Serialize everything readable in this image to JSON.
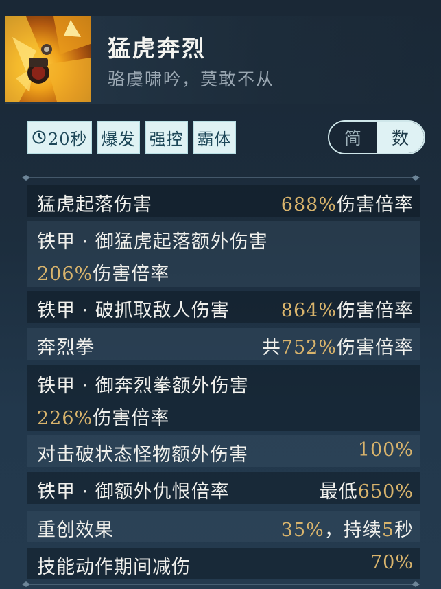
{
  "skill": {
    "name": "猛虎奔烈",
    "description": "骆虞啸吟，莫敢不从",
    "icon": "tiger-fist-skill-icon"
  },
  "tags": {
    "cooldown": "20秒",
    "tag1": "爆发",
    "tag2": "强控",
    "tag3": "霸体"
  },
  "view_toggle": {
    "simple": "简",
    "numeric": "数",
    "selected": "数"
  },
  "stats": {
    "r1": {
      "label": "猛虎起落伤害",
      "value": "688%",
      "suffix": "伤害倍率"
    },
    "r2": {
      "label": "铁甲 · 御猛虎起落额外伤害",
      "value": "206%",
      "suffix": "伤害倍率"
    },
    "r3": {
      "label": "铁甲 · 破抓取敌人伤害",
      "value": "864%",
      "suffix": "伤害倍率"
    },
    "r4": {
      "label": "奔烈拳",
      "prefix": "共",
      "value": "752%",
      "suffix": "伤害倍率"
    },
    "r5": {
      "label": "铁甲 · 御奔烈拳额外伤害",
      "value": "226%",
      "suffix": "伤害倍率"
    },
    "r6": {
      "label": "对击破状态怪物额外伤害",
      "value": "100%"
    },
    "r7": {
      "label": "铁甲 · 御额外仇恨倍率",
      "prefix": "最低",
      "value": "650%"
    },
    "r8": {
      "label": "重创效果",
      "value": "35%",
      "sep": "，持续",
      "duration": "5",
      "unit": "秒"
    },
    "r9": {
      "label": "技能动作期间减伤",
      "value": "70%"
    }
  },
  "colors": {
    "accent_gold": "#d9b46c",
    "tag_bg": "#dff2f4",
    "text": "#f0f0ec"
  }
}
